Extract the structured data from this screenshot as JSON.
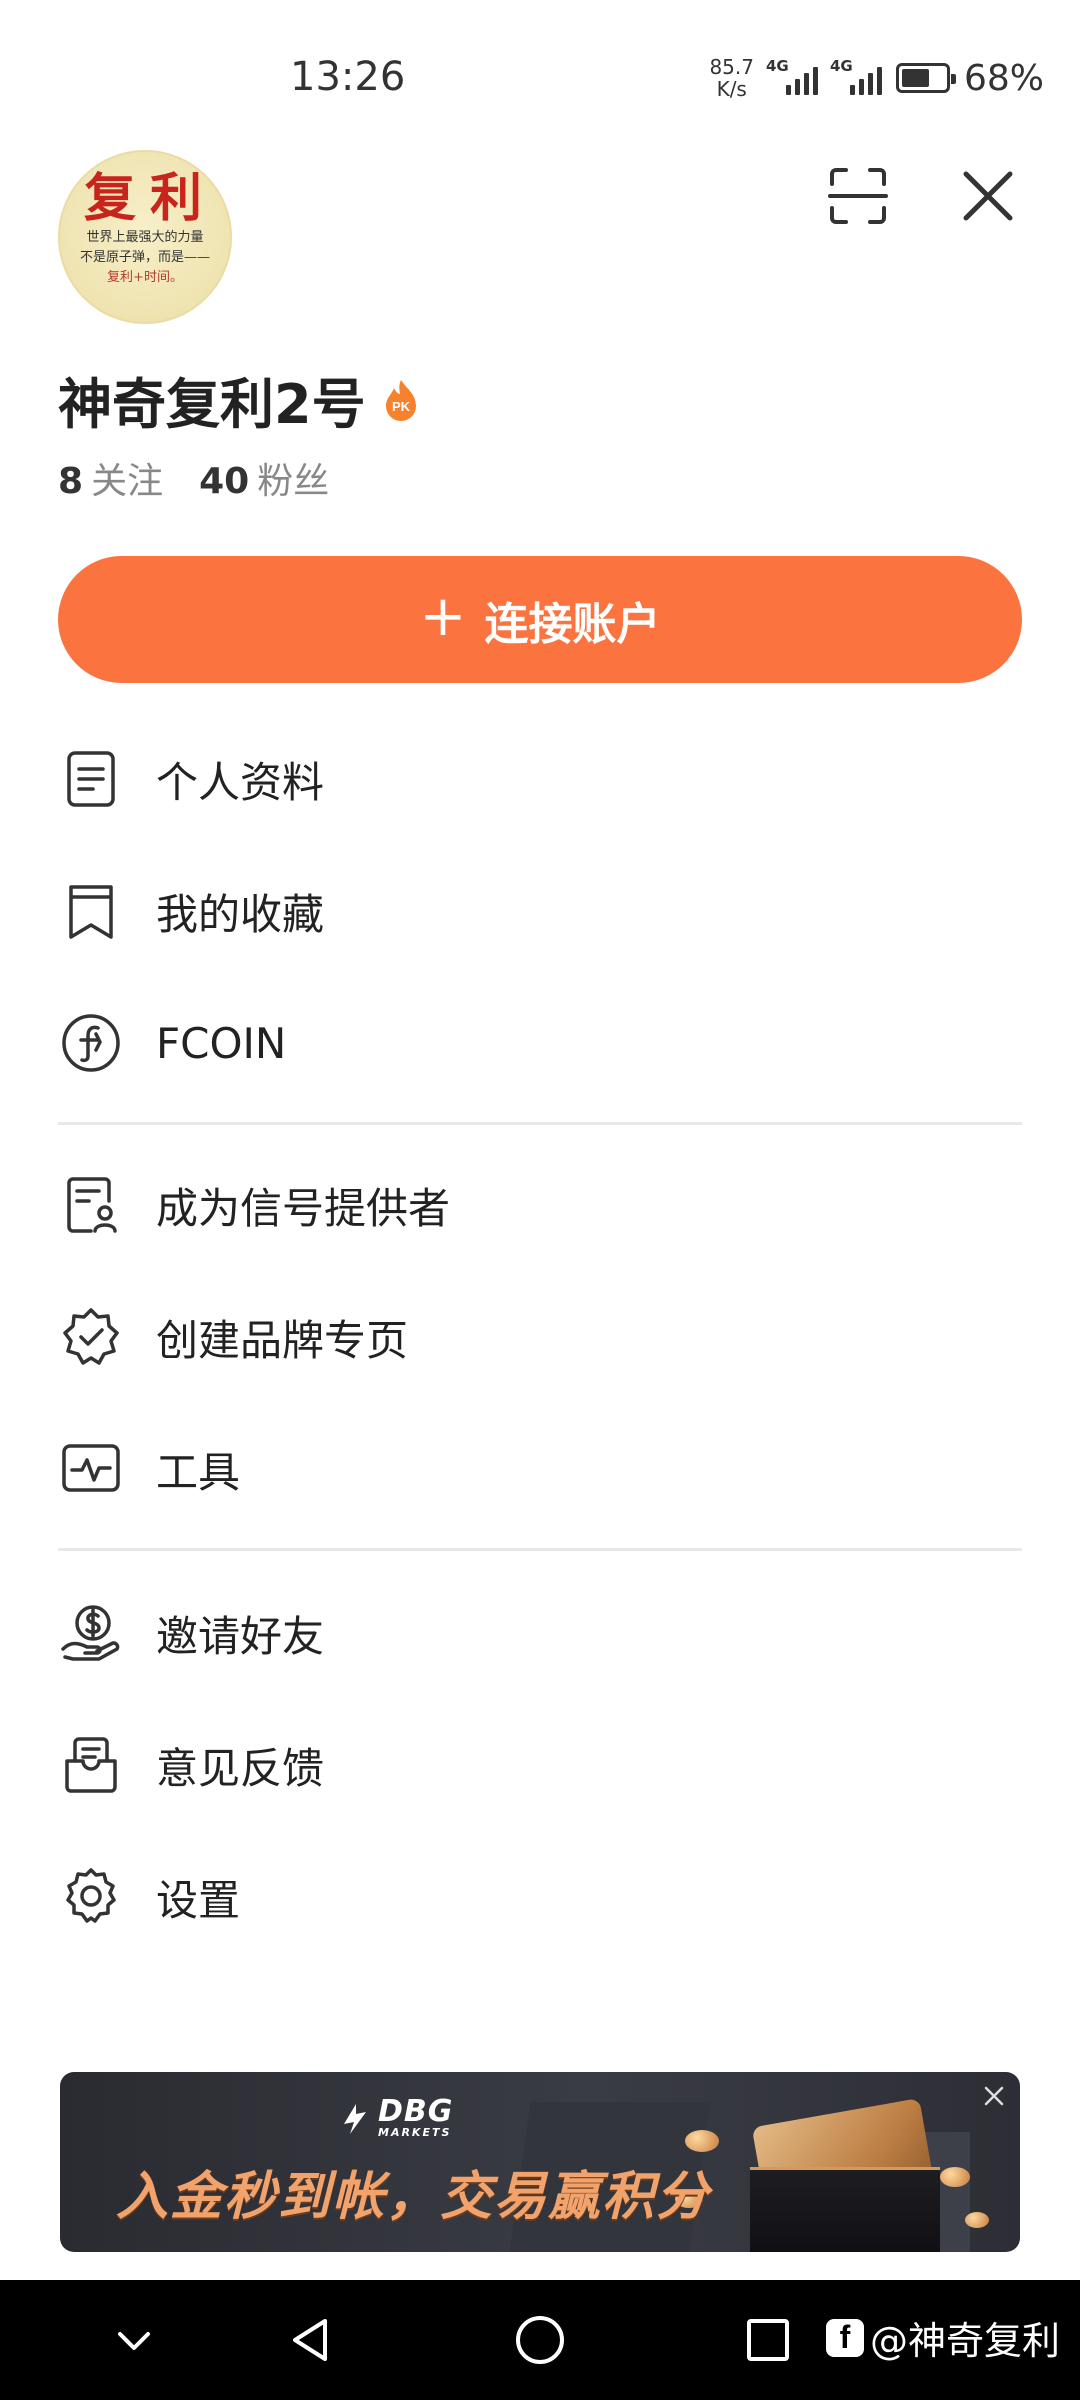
{
  "status_bar": {
    "time": "13:26",
    "net_speed_value": "85.7",
    "net_speed_unit": "K/s",
    "sim1": "4G",
    "sim2": "4G",
    "battery_level": 0.68,
    "battery_text": "68%"
  },
  "profile": {
    "avatar_title": "复利",
    "avatar_line1": "世界上最强大的力量",
    "avatar_line2": "不是原子弹，而是——",
    "avatar_line3": "复利+时间。",
    "username": "神奇复利2号",
    "following_count": "8",
    "following_label": "关注",
    "followers_count": "40",
    "followers_label": "粉丝"
  },
  "connect_button": {
    "icon": "+",
    "label": "连接账户",
    "color": "#fb7440"
  },
  "menu": {
    "section1": [
      {
        "label": "个人资料",
        "icon": "document-icon"
      },
      {
        "label": "我的收藏",
        "icon": "bookmark-icon"
      },
      {
        "label": "FCOIN",
        "icon": "fcoin-icon"
      }
    ],
    "section2": [
      {
        "label": "成为信号提供者",
        "icon": "signal-provider-icon"
      },
      {
        "label": "创建品牌专页",
        "icon": "verified-badge-icon"
      },
      {
        "label": "工具",
        "icon": "tools-pulse-icon"
      }
    ],
    "section3": [
      {
        "label": "邀请好友",
        "icon": "invite-money-icon"
      },
      {
        "label": "意见反馈",
        "icon": "feedback-icon"
      },
      {
        "label": "设置",
        "icon": "gear-icon"
      }
    ]
  },
  "banner": {
    "brand_name": "DBG",
    "brand_sub": "MARKETS",
    "text": "入金秒到帐，交易赢积分"
  },
  "nav_bar": {
    "watermark": "@神奇复利",
    "watermark_logo": "f"
  }
}
